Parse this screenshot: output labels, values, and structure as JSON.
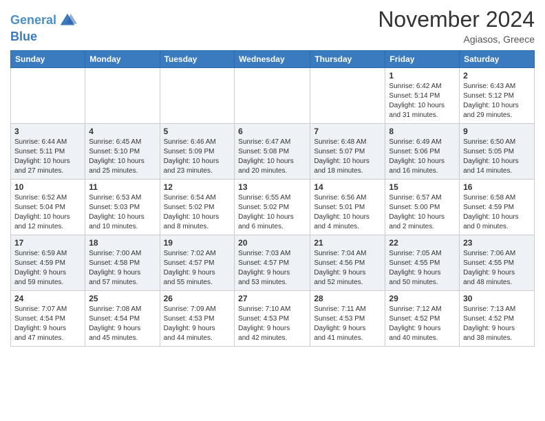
{
  "header": {
    "logo_line1": "General",
    "logo_line2": "Blue",
    "month": "November 2024",
    "location": "Agiasos, Greece"
  },
  "days_of_week": [
    "Sunday",
    "Monday",
    "Tuesday",
    "Wednesday",
    "Thursday",
    "Friday",
    "Saturday"
  ],
  "weeks": [
    [
      {
        "day": "",
        "info": ""
      },
      {
        "day": "",
        "info": ""
      },
      {
        "day": "",
        "info": ""
      },
      {
        "day": "",
        "info": ""
      },
      {
        "day": "",
        "info": ""
      },
      {
        "day": "1",
        "info": "Sunrise: 6:42 AM\nSunset: 5:14 PM\nDaylight: 10 hours\nand 31 minutes."
      },
      {
        "day": "2",
        "info": "Sunrise: 6:43 AM\nSunset: 5:12 PM\nDaylight: 10 hours\nand 29 minutes."
      }
    ],
    [
      {
        "day": "3",
        "info": "Sunrise: 6:44 AM\nSunset: 5:11 PM\nDaylight: 10 hours\nand 27 minutes."
      },
      {
        "day": "4",
        "info": "Sunrise: 6:45 AM\nSunset: 5:10 PM\nDaylight: 10 hours\nand 25 minutes."
      },
      {
        "day": "5",
        "info": "Sunrise: 6:46 AM\nSunset: 5:09 PM\nDaylight: 10 hours\nand 23 minutes."
      },
      {
        "day": "6",
        "info": "Sunrise: 6:47 AM\nSunset: 5:08 PM\nDaylight: 10 hours\nand 20 minutes."
      },
      {
        "day": "7",
        "info": "Sunrise: 6:48 AM\nSunset: 5:07 PM\nDaylight: 10 hours\nand 18 minutes."
      },
      {
        "day": "8",
        "info": "Sunrise: 6:49 AM\nSunset: 5:06 PM\nDaylight: 10 hours\nand 16 minutes."
      },
      {
        "day": "9",
        "info": "Sunrise: 6:50 AM\nSunset: 5:05 PM\nDaylight: 10 hours\nand 14 minutes."
      }
    ],
    [
      {
        "day": "10",
        "info": "Sunrise: 6:52 AM\nSunset: 5:04 PM\nDaylight: 10 hours\nand 12 minutes."
      },
      {
        "day": "11",
        "info": "Sunrise: 6:53 AM\nSunset: 5:03 PM\nDaylight: 10 hours\nand 10 minutes."
      },
      {
        "day": "12",
        "info": "Sunrise: 6:54 AM\nSunset: 5:02 PM\nDaylight: 10 hours\nand 8 minutes."
      },
      {
        "day": "13",
        "info": "Sunrise: 6:55 AM\nSunset: 5:02 PM\nDaylight: 10 hours\nand 6 minutes."
      },
      {
        "day": "14",
        "info": "Sunrise: 6:56 AM\nSunset: 5:01 PM\nDaylight: 10 hours\nand 4 minutes."
      },
      {
        "day": "15",
        "info": "Sunrise: 6:57 AM\nSunset: 5:00 PM\nDaylight: 10 hours\nand 2 minutes."
      },
      {
        "day": "16",
        "info": "Sunrise: 6:58 AM\nSunset: 4:59 PM\nDaylight: 10 hours\nand 0 minutes."
      }
    ],
    [
      {
        "day": "17",
        "info": "Sunrise: 6:59 AM\nSunset: 4:59 PM\nDaylight: 9 hours\nand 59 minutes."
      },
      {
        "day": "18",
        "info": "Sunrise: 7:00 AM\nSunset: 4:58 PM\nDaylight: 9 hours\nand 57 minutes."
      },
      {
        "day": "19",
        "info": "Sunrise: 7:02 AM\nSunset: 4:57 PM\nDaylight: 9 hours\nand 55 minutes."
      },
      {
        "day": "20",
        "info": "Sunrise: 7:03 AM\nSunset: 4:57 PM\nDaylight: 9 hours\nand 53 minutes."
      },
      {
        "day": "21",
        "info": "Sunrise: 7:04 AM\nSunset: 4:56 PM\nDaylight: 9 hours\nand 52 minutes."
      },
      {
        "day": "22",
        "info": "Sunrise: 7:05 AM\nSunset: 4:55 PM\nDaylight: 9 hours\nand 50 minutes."
      },
      {
        "day": "23",
        "info": "Sunrise: 7:06 AM\nSunset: 4:55 PM\nDaylight: 9 hours\nand 48 minutes."
      }
    ],
    [
      {
        "day": "24",
        "info": "Sunrise: 7:07 AM\nSunset: 4:54 PM\nDaylight: 9 hours\nand 47 minutes."
      },
      {
        "day": "25",
        "info": "Sunrise: 7:08 AM\nSunset: 4:54 PM\nDaylight: 9 hours\nand 45 minutes."
      },
      {
        "day": "26",
        "info": "Sunrise: 7:09 AM\nSunset: 4:53 PM\nDaylight: 9 hours\nand 44 minutes."
      },
      {
        "day": "27",
        "info": "Sunrise: 7:10 AM\nSunset: 4:53 PM\nDaylight: 9 hours\nand 42 minutes."
      },
      {
        "day": "28",
        "info": "Sunrise: 7:11 AM\nSunset: 4:53 PM\nDaylight: 9 hours\nand 41 minutes."
      },
      {
        "day": "29",
        "info": "Sunrise: 7:12 AM\nSunset: 4:52 PM\nDaylight: 9 hours\nand 40 minutes."
      },
      {
        "day": "30",
        "info": "Sunrise: 7:13 AM\nSunset: 4:52 PM\nDaylight: 9 hours\nand 38 minutes."
      }
    ]
  ]
}
